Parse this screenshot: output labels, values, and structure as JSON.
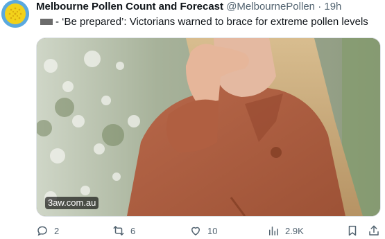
{
  "tweet": {
    "display_name": "Melbourne Pollen Count and Forecast",
    "handle": "@MelbournePollen",
    "separator": "·",
    "time": "19h",
    "text": "- ‘Be prepared’: Victorians warned to brace for extreme pollen levels",
    "media_source": "3aw.com.au"
  },
  "actions": {
    "replies": "2",
    "retweets": "6",
    "likes": "10",
    "views": "2.9K"
  },
  "icons": {
    "avatar": "yellow-flower-avatar",
    "reply": "speech-bubble-icon",
    "retweet": "retweet-arrows-icon",
    "like": "heart-icon",
    "views": "bar-chart-icon",
    "bookmark": "bookmark-icon",
    "share": "share-upload-icon"
  },
  "colors": {
    "text": "#0f1419",
    "muted": "#536471",
    "avatar_bg": "#5aa9df",
    "avatar_flower": "#f2d21b"
  }
}
